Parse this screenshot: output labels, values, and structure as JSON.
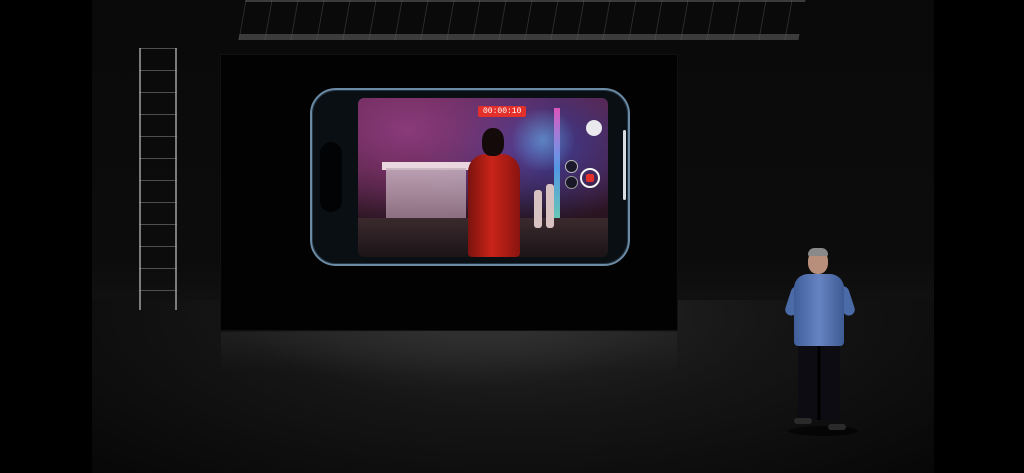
{
  "scene": {
    "viewfinder": {
      "recording_timer": "00:00:10"
    }
  },
  "colors": {
    "letterbox": "#000000",
    "phone_frame": "#6b8aa3",
    "record_red": "#e3302b",
    "presenter_shirt": "#5b79b8"
  }
}
